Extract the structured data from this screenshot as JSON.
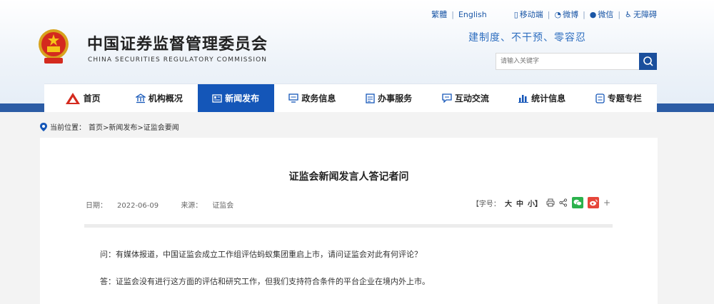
{
  "topbar": {
    "traditional": "繁體",
    "english": "English",
    "mobile": "移动端",
    "weibo": "微博",
    "wechat": "微信",
    "accessible": "无障碍"
  },
  "header": {
    "title": "中国证券监督管理委员会",
    "subtitle": "CHINA SECURITIES REGULATORY COMMISSION",
    "slogan": "建制度、不干预、零容忍",
    "search_placeholder": "请输入关键字"
  },
  "nav": {
    "items": [
      {
        "label": "首页",
        "icon": "home-emblem-icon"
      },
      {
        "label": "机构概况",
        "icon": "building-icon"
      },
      {
        "label": "新闻发布",
        "icon": "news-icon"
      },
      {
        "label": "政务信息",
        "icon": "monitor-icon"
      },
      {
        "label": "办事服务",
        "icon": "document-icon"
      },
      {
        "label": "互动交流",
        "icon": "chat-icon"
      },
      {
        "label": "统计信息",
        "icon": "bar-chart-icon"
      },
      {
        "label": "专题专栏",
        "icon": "topic-icon"
      }
    ],
    "active": "新闻发布"
  },
  "breadcrumb": {
    "label": "当前位置：",
    "path": "首页>新闻发布>证监会要闻"
  },
  "article": {
    "title": "证监会新闻发言人答记者问",
    "date_label": "日期：",
    "date": "2022-06-09",
    "source_label": "来源：",
    "source": "证监会",
    "font_size_label": "【字号：",
    "size_large": "大",
    "size_medium": "中",
    "size_small": "小】",
    "plus": "+",
    "question": "问：有媒体报道，中国证监会成立工作组评估蚂蚁集团重启上市，请问证监会对此有何评论？",
    "answer": "答：证监会没有进行这方面的评估和研究工作，但我们支持符合条件的平台企业在境内外上市。"
  },
  "colors": {
    "brand_blue": "#1456b8",
    "nav_band": "#2b5ca5",
    "link_blue": "#1a56a6"
  }
}
